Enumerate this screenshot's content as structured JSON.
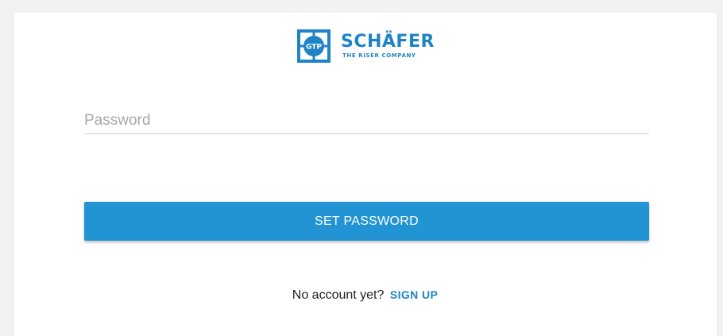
{
  "brand": {
    "icon": "gtp-logo-icon",
    "mark_text": "GTP",
    "name": "SCHÄFER",
    "tagline": "THE RISER COMPANY",
    "color": "#1f84c6"
  },
  "form": {
    "password_placeholder": "Password",
    "password_value": ""
  },
  "button": {
    "label": "SET PASSWORD",
    "color": "#2394d3"
  },
  "footer": {
    "prompt": "No account yet?",
    "signup_label": "SIGN UP"
  }
}
